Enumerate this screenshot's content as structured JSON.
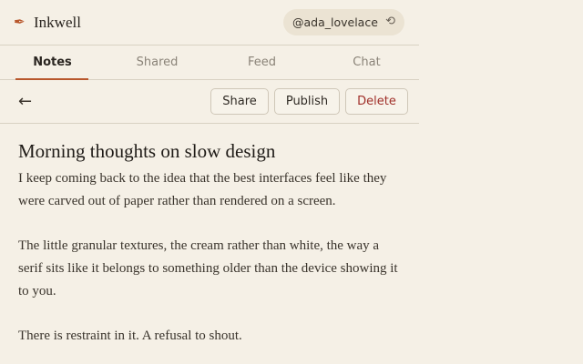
{
  "app": {
    "title": "Inkwell",
    "logo_icon": "quill-pen-icon"
  },
  "user": {
    "handle": "@ada_lovelace",
    "sync_icon": "sync-icon"
  },
  "tabs": [
    {
      "label": "Notes",
      "active": true
    },
    {
      "label": "Shared",
      "active": false
    },
    {
      "label": "Feed",
      "active": false
    },
    {
      "label": "Chat",
      "active": false
    }
  ],
  "toolbar": {
    "back_icon": "back-arrow-icon",
    "share_label": "Share",
    "publish_label": "Publish",
    "delete_label": "Delete"
  },
  "note": {
    "title": "Morning thoughts on slow design",
    "paragraphs": [
      "I keep coming back to the idea that the best interfaces feel like they were carved out of paper rather than rendered on a screen.",
      "The little granular textures, the cream rather than white, the way a serif sits like it belongs to something older than the device showing it to you.",
      "There is restraint in it. A refusal to shout."
    ]
  },
  "colors": {
    "accent": "#b8572c",
    "background": "#f5f0e6",
    "danger": "#a0302a"
  }
}
